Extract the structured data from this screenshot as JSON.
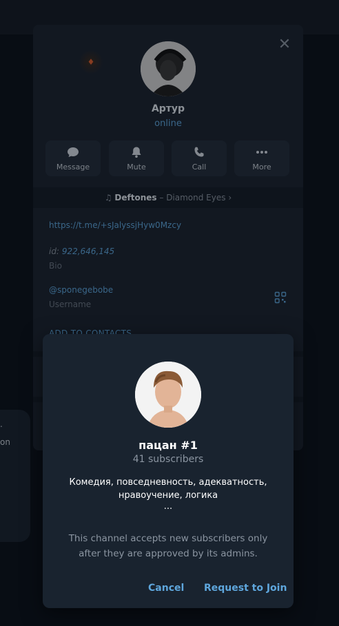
{
  "background": {
    "bubble_line1": ".",
    "bubble_line2": "on"
  },
  "profile": {
    "name": "Артур",
    "status": "online",
    "actions": [
      {
        "label": "Message",
        "icon": "message-icon"
      },
      {
        "label": "Mute",
        "icon": "bell-icon"
      },
      {
        "label": "Call",
        "icon": "phone-icon"
      },
      {
        "label": "More",
        "icon": "more-icon"
      }
    ],
    "music": {
      "note": "♫",
      "artist": "Deftones",
      "separator": " – ",
      "track": "Diamond Eyes",
      "chevron": "›"
    },
    "link": "https://t.me/+sJalyssjHyw0Mzcy",
    "id_label": "id:",
    "id_value": "922,646,145",
    "bio_label": "Bio",
    "username": "@sponegebobe",
    "username_label": "Username",
    "add_contacts": "ADD TO CONTACTS"
  },
  "dialog": {
    "title": "пацан #1",
    "subscribers": "41 subscribers",
    "description_line1": "Комедия, повседневность, адекватность,",
    "description_line2": "нравоучение, логика",
    "description_ellipsis": "...",
    "note_line1": "This channel accepts new subscribers only",
    "note_line2": "after they are approved by its admins.",
    "cancel_label": "Cancel",
    "request_label": "Request to Join"
  },
  "colors": {
    "accent": "#5ea6dc",
    "panel": "#1b2430",
    "dialog": "#19232f",
    "background": "#0b111a"
  }
}
